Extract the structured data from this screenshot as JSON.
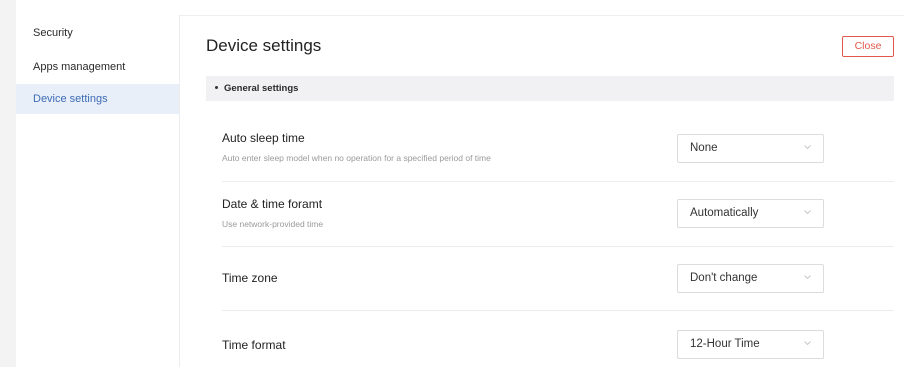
{
  "sidebar": {
    "items": [
      {
        "label": "Security"
      },
      {
        "label": "Apps management"
      },
      {
        "label": "Device settings"
      }
    ]
  },
  "header": {
    "title": "Device settings",
    "close_label": "Close"
  },
  "section": {
    "title": "General settings"
  },
  "settings": [
    {
      "title": "Auto sleep time",
      "description": "Auto enter sleep model when no operation for a specified period of time",
      "value": "None"
    },
    {
      "title": "Date & time foramt",
      "description": "Use network-provided time",
      "value": "Automatically"
    },
    {
      "title": "Time zone",
      "description": "",
      "value": "Don't change"
    },
    {
      "title": "Time format",
      "description": "",
      "value": "12-Hour Time"
    }
  ],
  "colors": {
    "accent": "#3d6cb5",
    "active_bg": "#e9eff8",
    "danger": "#e0584b"
  },
  "icons": {
    "select_chevron": "chevron-down-icon"
  }
}
